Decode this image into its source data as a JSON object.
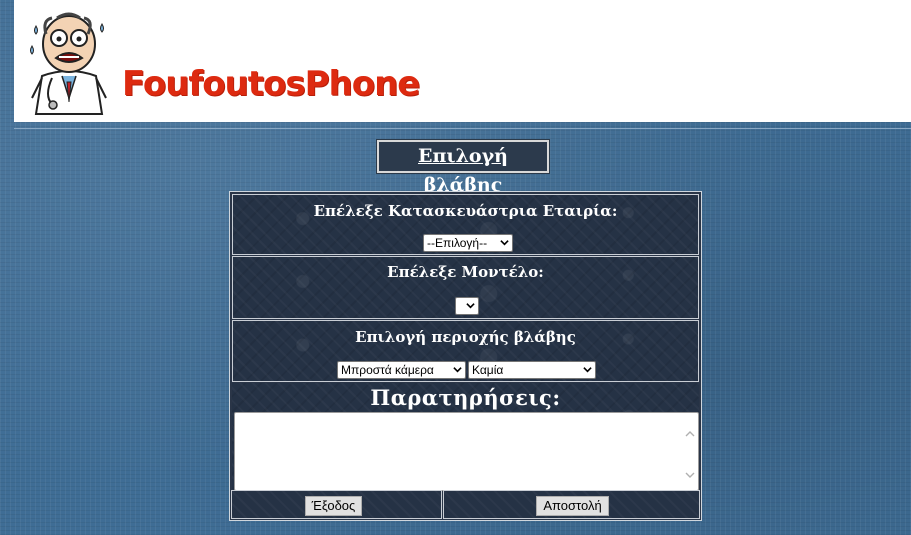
{
  "header": {
    "brand_name": "FoufoutosPhone"
  },
  "page_title": "Επιλογή βλάβης",
  "form": {
    "manufacturer": {
      "label": "Επέλεξε Κατασκευάστρια Εταιρία:",
      "selected": "--Επιλογή--"
    },
    "model": {
      "label": "Επέλεξε Μοντέλο:",
      "selected": ""
    },
    "damage_area": {
      "label": "Επιλογή περιοχής βλάβης",
      "area_selected": "Μπροστά κάμερα",
      "damage_selected": "Καμία"
    },
    "notes": {
      "label": "Παρατηρήσεις:",
      "value": ""
    },
    "buttons": {
      "exit_label": "Έξοδος",
      "submit_label": "Αποστολή"
    }
  },
  "colors": {
    "brand_red": "#dd2a10",
    "background_blue": "#3f6d95",
    "panel_dark": "#253245"
  },
  "icons": {
    "logo": "worried-doctor-cartoon",
    "select_arrow": "chevron-down-icon",
    "scroll_up": "scroll-up-arrow-icon",
    "scroll_down": "scroll-down-arrow-icon"
  }
}
